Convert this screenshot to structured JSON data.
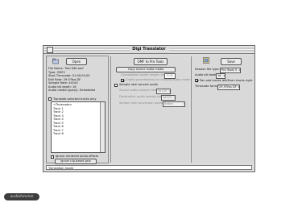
{
  "window": {
    "title": "Digi Translator"
  },
  "left": {
    "icon_name": "folder-icon",
    "open_label": "Open",
    "info": [
      "File Name: Trial Edit.omf",
      "Type: OMF2",
      "Start Timecode: 01:00:00,00",
      "Edit Rate: 29.97fps DF",
      "Sample Rate: 44100",
      "Audio bit depth: 16",
      "Audio media type(s): Embedded"
    ],
    "translate_selected_label": "Translate selected tracks only",
    "tracks_header": "<Timecode>",
    "tracks": [
      "Track 1",
      "Track 2",
      "Track 3",
      "Track 4",
      "Track 5",
      "Track 6",
      "Track 7",
      "Track 8"
    ],
    "ignore_rendered_label": "Ignore rendered audio effects",
    "ignore_clip_label": "Ignore clip-based gain"
  },
  "middle": {
    "omf_button": "OMF to Pro Tools",
    "copy_button": "Copy source audio media",
    "consolidate_label": "Consolidate handle length (ms):",
    "consolidate_value": "1000",
    "create_placeholders_label": "Create placeholders for missing audio media",
    "sample_rate_convert_label": "Sample rate convert audio",
    "source_rate_label": "Source audio sample rate:",
    "source_rate_value": "44100",
    "dest_rate_label": "Destination audio sample rate:",
    "dest_rate_value": "48000",
    "quality_label": "Sample rate conversion quality:",
    "quality_value": "Better"
  },
  "right": {
    "icon_name": "pro-tools-session-icon",
    "save_label": "Save",
    "session_type_label": "Session file type:",
    "session_type_value": "Pro Tools 5",
    "bit_depth_label": "Audio bit depth:",
    "bit_depth_value": "16",
    "pan_odd_label": "Pan odd tracks left/Even tracks right",
    "timecode_format_label": "Timecode format:",
    "timecode_format_value": "29.97fps DF"
  },
  "status": {
    "text": "Translation mode"
  },
  "watermark": {
    "text": "audiofanzine"
  }
}
